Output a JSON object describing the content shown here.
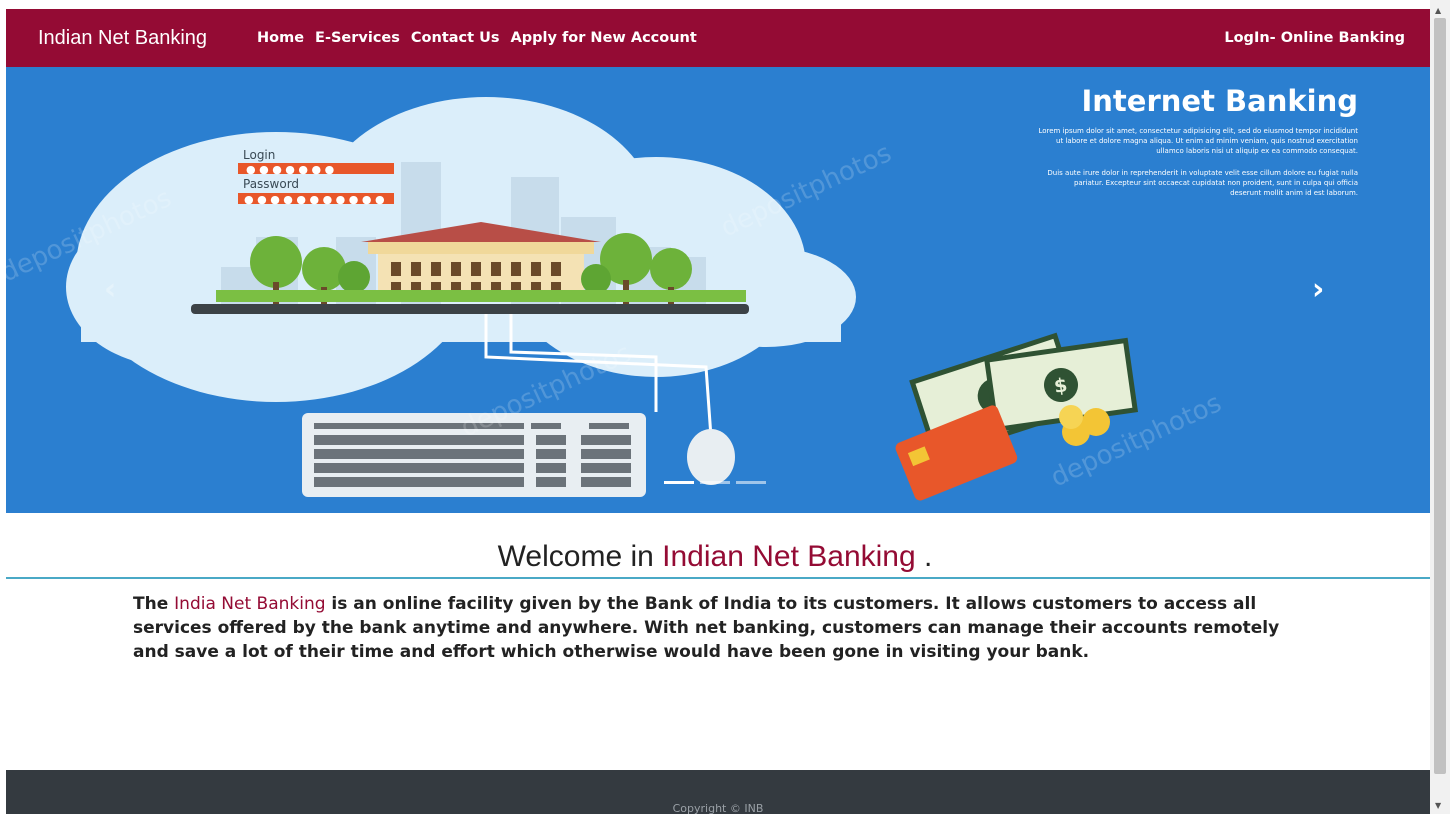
{
  "navbar": {
    "brand": "Indian Net Banking",
    "links": [
      "Home",
      "E-Services",
      "Contact Us",
      "Apply for New Account"
    ],
    "login": "LogIn- Online Banking",
    "color": "#940b34"
  },
  "carousel": {
    "heading": "Internet Banking",
    "login_label": "Login",
    "password_label": "Password",
    "watermark": "depositphotos",
    "paragraph1": [
      "Lorem ipsum dolor sit amet, consectetur adipisicing elit, sed do eiusmod tempor incididunt",
      "ut labore et dolore magna aliqua. Ut enim ad minim veniam, quis nostrud exercitation",
      "ullamco laboris nisi ut aliquip ex ea commodo consequat."
    ],
    "paragraph2": [
      "Duis aute irure dolor in reprehenderit in voluptate velit esse cillum dolore eu fugiat nulla",
      "pariatur. Excepteur sint occaecat cupidatat non proident, sunt in culpa qui officia",
      "deserunt mollit anim id est laborum."
    ],
    "prev_icon": "chevron-left-icon",
    "next_icon": "chevron-right-icon",
    "next_glyph": "›",
    "prev_glyph": "‹",
    "indicator_count": 3,
    "active_indicator": 1,
    "background": "#2b7fd0"
  },
  "welcome": {
    "prefix": "Welcome in ",
    "highlight": "Indian Net Banking",
    "suffix": " ."
  },
  "intro": {
    "prefix": "The ",
    "highlight": "India Net Banking",
    "rest": " is an online facility given by the Bank of India to its customers. It allows customers to access all services offered by the bank anytime and anywhere. With net banking, customers can manage their accounts remotely and save a lot of their time and effort which otherwise would have been gone in visiting your bank."
  },
  "footer": {
    "copyright": "Copyright © INB",
    "background": "#343a40"
  }
}
